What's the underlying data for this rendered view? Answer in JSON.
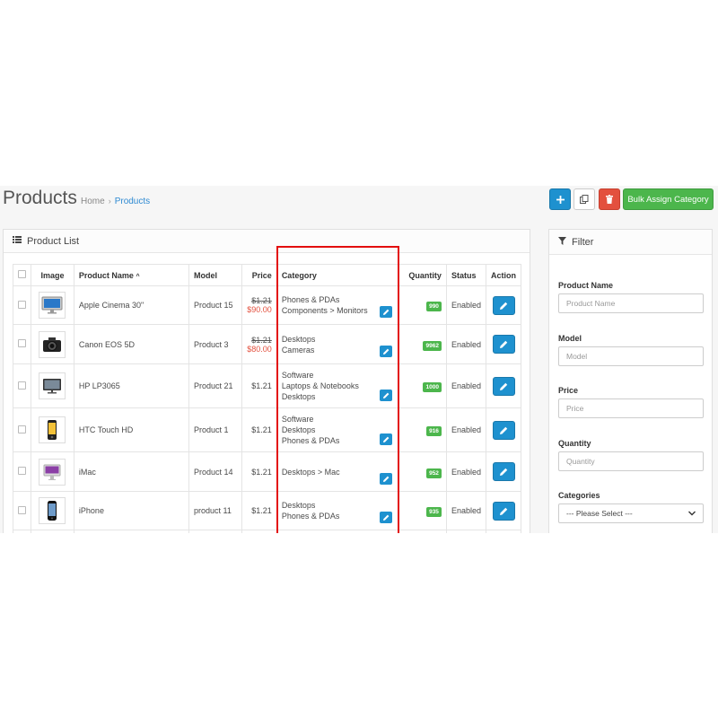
{
  "header": {
    "title": "Products",
    "breadcrumb": [
      "Home",
      "Products"
    ],
    "bulk_label": "Bulk Assign Category"
  },
  "list": {
    "panel_title": "Product List",
    "columns": {
      "image": "Image",
      "name": "Product Name",
      "model": "Model",
      "price": "Price",
      "category": "Category",
      "quantity": "Quantity",
      "status": "Status",
      "action": "Action"
    },
    "rows": [
      {
        "name": "Apple Cinema 30\"",
        "model": "Product 15",
        "price": "$1.21",
        "special": "$90.00",
        "categories": [
          "Phones & PDAs",
          "Components > Monitors"
        ],
        "quantity": "990",
        "status": "Enabled"
      },
      {
        "name": "Canon EOS 5D",
        "model": "Product 3",
        "price": "$1.21",
        "special": "$80.00",
        "categories": [
          "Desktops",
          "Cameras"
        ],
        "quantity": "9962",
        "status": "Enabled"
      },
      {
        "name": "HP LP3065",
        "model": "Product 21",
        "price": "$1.21",
        "special": "",
        "categories": [
          "Software",
          "Laptops & Notebooks",
          "Desktops"
        ],
        "quantity": "1000",
        "status": "Enabled"
      },
      {
        "name": "HTC Touch HD",
        "model": "Product 1",
        "price": "$1.21",
        "special": "",
        "categories": [
          "Software",
          "Desktops",
          "Phones & PDAs"
        ],
        "quantity": "916",
        "status": "Enabled"
      },
      {
        "name": "iMac",
        "model": "Product 14",
        "price": "$1.21",
        "special": "",
        "categories": [
          "Desktops > Mac"
        ],
        "quantity": "952",
        "status": "Enabled"
      },
      {
        "name": "iPhone",
        "model": "product 11",
        "price": "$1.21",
        "special": "",
        "categories": [
          "Desktops",
          "Phones & PDAs"
        ],
        "quantity": "935",
        "status": "Enabled"
      }
    ]
  },
  "filter": {
    "panel_title": "Filter",
    "product_name_label": "Product Name",
    "product_name_placeholder": "Product Name",
    "model_label": "Model",
    "model_placeholder": "Model",
    "price_label": "Price",
    "price_placeholder": "Price",
    "quantity_label": "Quantity",
    "quantity_placeholder": "Quantity",
    "categories_label": "Categories",
    "categories_selected": "--- Please Select ---"
  },
  "colors": {
    "primary": "#1e91cf",
    "danger": "#e3503e",
    "success": "#4cb64c",
    "highlight": "#e30e0e"
  }
}
